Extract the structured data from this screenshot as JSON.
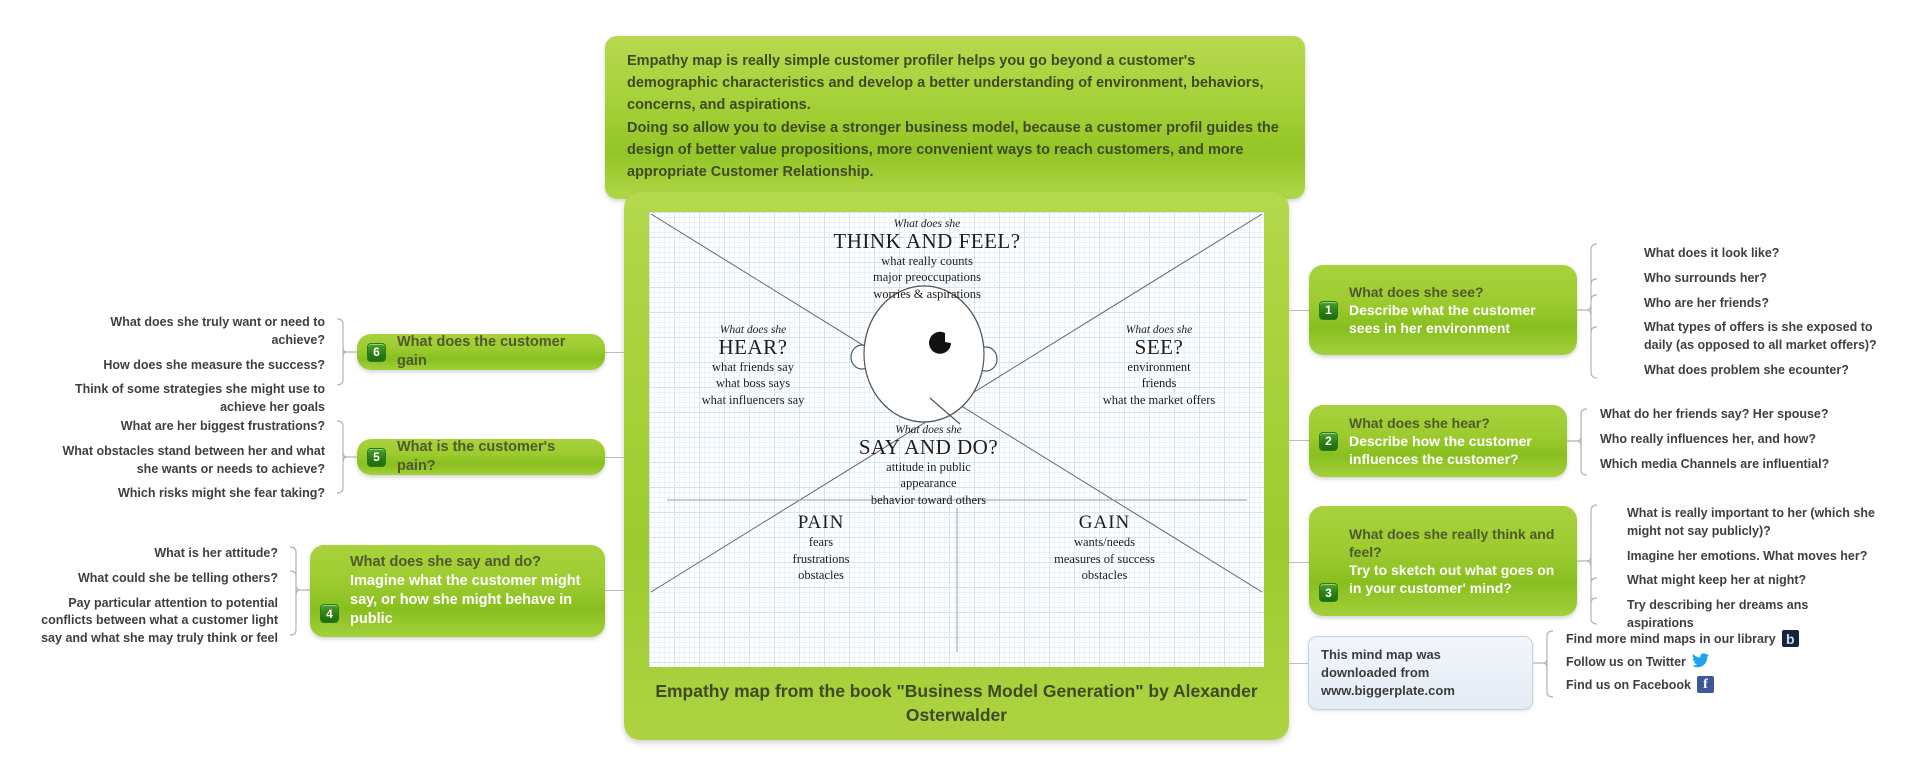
{
  "description": {
    "paragraphs": [
      "Empathy map is really simple customer profiler helps you go beyond a customer's demographic characteristics and develop a better understanding of environment, behaviors, concerns, and aspirations.",
      "Doing so allow you to devise a stronger business model, because a customer profil guides the design of better value propositions, more convenient ways to reach customers, and more appropriate Customer Relationship."
    ]
  },
  "map": {
    "caption": "Empathy map from the book \"Business Model Generation\" by Alexander Osterwalder",
    "quadrants": {
      "think": {
        "pre": "What does she",
        "title": "THINK AND FEEL?",
        "lines": [
          "what really counts",
          "major preoccupations",
          "worries & aspirations"
        ]
      },
      "hear": {
        "pre": "What does she",
        "title": "HEAR?",
        "lines": [
          "what friends say",
          "what boss says",
          "what influencers say"
        ]
      },
      "see": {
        "pre": "What does she",
        "title": "SEE?",
        "lines": [
          "environment",
          "friends",
          "what the market offers"
        ]
      },
      "say": {
        "pre": "What does she",
        "title": "SAY AND DO?",
        "lines": [
          "attitude in public",
          "appearance",
          "behavior toward others"
        ]
      }
    },
    "bottom": {
      "pain": {
        "title": "PAIN",
        "lines": [
          "fears",
          "frustrations",
          "obstacles"
        ]
      },
      "gain": {
        "title": "GAIN",
        "lines": [
          "wants/needs",
          "measures of success",
          "obstacles"
        ]
      }
    }
  },
  "nodes": {
    "see": {
      "number": "1",
      "title": "What does she see?",
      "detail": "Describe what the customer sees in her environment",
      "leaves": [
        "What does it look like?",
        "Who surrounds her?",
        "Who are her friends?",
        "What types of offers is she exposed to daily (as opposed to all market offers)?",
        "What does problem she ecounter?"
      ]
    },
    "hear": {
      "number": "2",
      "title": "What does she hear?",
      "detail": "Describe how the customer influences the customer?",
      "leaves": [
        "What do her friends say? Her spouse?",
        "Who really influences her, and how?",
        "Which media Channels are influential?"
      ]
    },
    "think": {
      "number": "3",
      "title": "What does she really think and feel?",
      "detail": "Try to sketch out what goes on in your customer' mind?",
      "leaves": [
        "What is really important to her (which she might not say publicly)?",
        "Imagine her emotions. What moves her?",
        "What might keep her at night?",
        "Try describing her dreams ans aspirations"
      ]
    },
    "say": {
      "number": "4",
      "title": "What does she say and do?",
      "detail": "Imagine what the customer might say, or how she might behave in public",
      "leaves": [
        "What is her attitude?",
        "What could she be telling others?",
        "Pay particular attention to potential conflicts between what a customer light say and what she may truly think or feel"
      ]
    },
    "pain": {
      "number": "5",
      "title": "What is the customer's pain?",
      "leaves": [
        "What are her biggest frustrations?",
        "What obstacles stand between her and what she wants or needs to achieve?",
        "Which risks might she fear taking?"
      ]
    },
    "gain": {
      "number": "6",
      "title": "What does the customer gain",
      "leaves": [
        "What does she truly want or need to achieve?",
        "How does she measure the success?",
        "Think of some strategies she might use to achieve her goals"
      ]
    }
  },
  "footer": {
    "download_note": "This mind map was downloaded from www.biggerplate.com",
    "links": [
      {
        "label": "Find more mind maps in our library",
        "icon": "biggerplate-icon"
      },
      {
        "label": "Follow us on Twitter",
        "icon": "twitter-icon"
      },
      {
        "label": "Find us on Facebook",
        "icon": "facebook-icon"
      }
    ]
  },
  "colors": {
    "accent_green": "#9ccb2f",
    "badge_green": "#2e7d16",
    "text_dark": "#3f3f3f",
    "grid_blue": "#cfe6f7"
  }
}
